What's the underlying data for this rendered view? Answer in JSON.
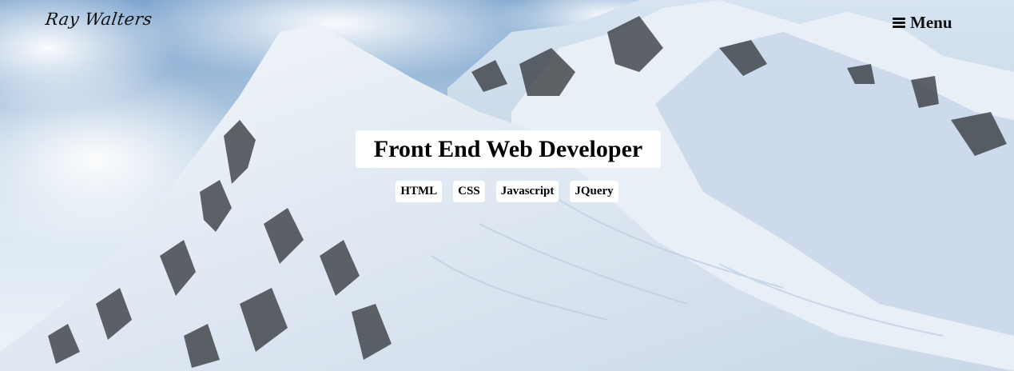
{
  "brand": {
    "name": "Ray Walters"
  },
  "nav": {
    "menu_label": "Menu",
    "menu_icon": "hamburger-icon"
  },
  "hero": {
    "title": "Front End Web Developer",
    "skills": [
      "HTML",
      "CSS",
      "Javascript",
      "JQuery"
    ]
  },
  "background": {
    "scene": "snowy-mountain-peaks"
  },
  "colors": {
    "text": "#000000",
    "label_bg": "#ffffff",
    "sky": "#7fa6cf",
    "snow": "#eef4fa"
  }
}
